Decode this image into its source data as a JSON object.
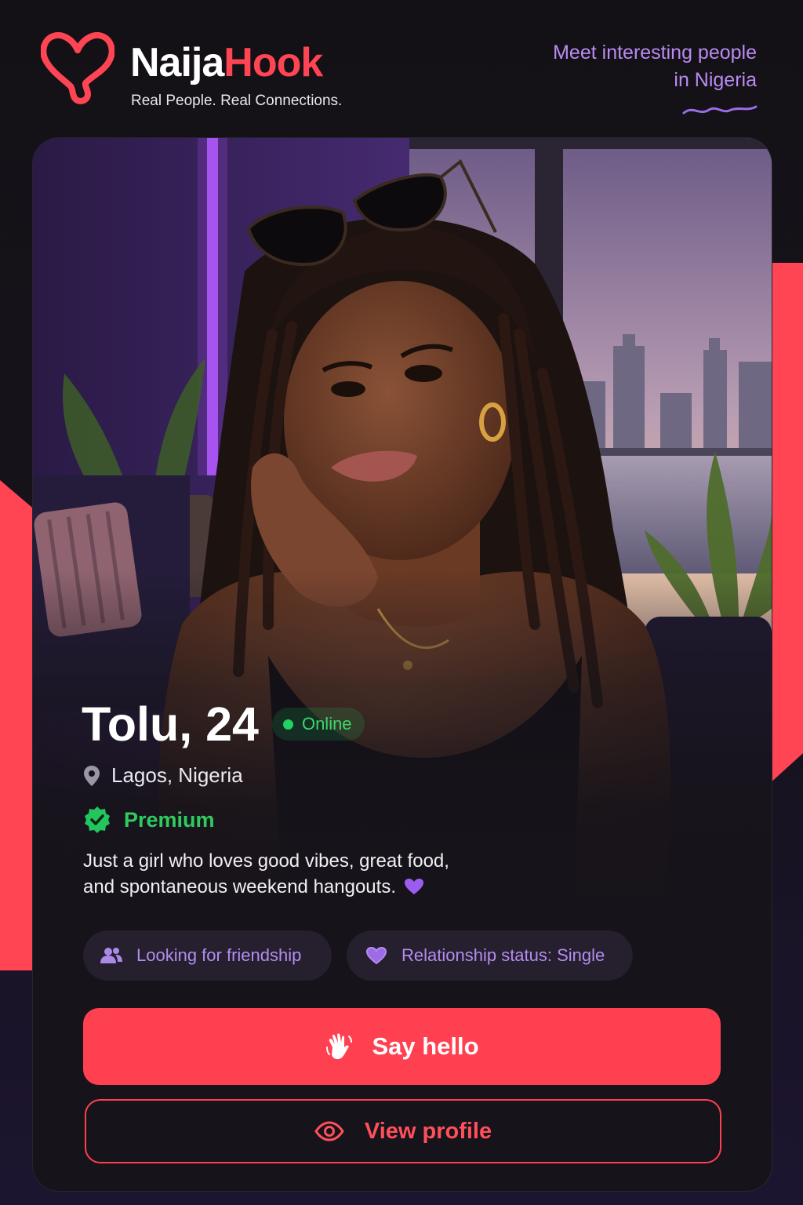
{
  "header": {
    "brand_part1": "Naija",
    "brand_part2": "Hook",
    "tagline": "Real People. Real Connections.",
    "promo_line1": "Meet interesting people",
    "promo_line2": "in Nigeria"
  },
  "profile": {
    "name_age": "Tolu, 24",
    "status": "Online",
    "location": "Lagos, Nigeria",
    "badge": "Premium",
    "bio_line1": "Just a girl who loves good vibes, great food,",
    "bio_line2": "and spontaneous weekend hangouts."
  },
  "tags": [
    {
      "label": "Looking for friendship",
      "icon": "users-icon"
    },
    {
      "label": "Relationship status: Single",
      "icon": "heart-icon"
    }
  ],
  "actions": {
    "primary_label": "Say hello",
    "primary_icon": "waving-hand-icon",
    "secondary_label": "View profile",
    "secondary_icon": "eye-icon"
  },
  "colors": {
    "accent": "#ff4050",
    "purple": "#b48cf0",
    "online_green": "#22d160",
    "background": "#141116"
  }
}
